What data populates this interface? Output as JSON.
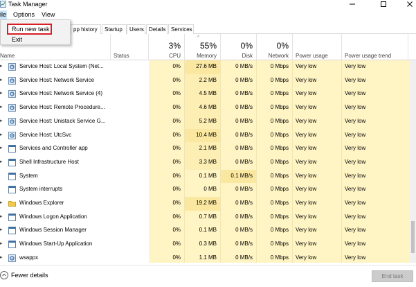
{
  "window": {
    "title": "Task Manager"
  },
  "menubar": {
    "file": "ile",
    "options": "Options",
    "view": "View"
  },
  "file_menu": {
    "items": [
      {
        "label": "Run new task"
      },
      {
        "label": "Exit"
      }
    ]
  },
  "tabs": [
    "pp history",
    "Startup",
    "Users",
    "Details",
    "Services"
  ],
  "columns": {
    "name": "Name",
    "status": "Status",
    "cpu": {
      "pct": "3%",
      "label": "CPU"
    },
    "memory": {
      "pct": "55%",
      "label": "Memory"
    },
    "disk": {
      "pct": "0%",
      "label": "Disk"
    },
    "network": {
      "pct": "0%",
      "label": "Network"
    },
    "power": "Power usage",
    "trend": "Power usage trend"
  },
  "rows": [
    {
      "expand": true,
      "icon": "gear-service-icon",
      "name": "Service Host: Local System (Net...",
      "cpu": "0%",
      "mem": "27.6 MB",
      "disk": "0 MB/s",
      "net": "0 Mbps",
      "power": "Very low",
      "trend": "Very low"
    },
    {
      "expand": true,
      "icon": "gear-service-icon",
      "name": "Service Host: Network Service",
      "cpu": "0%",
      "mem": "2.2 MB",
      "disk": "0 MB/s",
      "net": "0 Mbps",
      "power": "Very low",
      "trend": "Very low"
    },
    {
      "expand": true,
      "icon": "gear-service-icon",
      "name": "Service Host: Network Service (4)",
      "cpu": "0%",
      "mem": "4.5 MB",
      "disk": "0 MB/s",
      "net": "0 Mbps",
      "power": "Very low",
      "trend": "Very low"
    },
    {
      "expand": true,
      "icon": "gear-service-icon",
      "name": "Service Host: Remote Procedure...",
      "cpu": "0%",
      "mem": "4.6 MB",
      "disk": "0 MB/s",
      "net": "0 Mbps",
      "power": "Very low",
      "trend": "Very low"
    },
    {
      "expand": true,
      "icon": "gear-service-icon",
      "name": "Service Host: Unistack Service G...",
      "cpu": "0%",
      "mem": "5.2 MB",
      "disk": "0 MB/s",
      "net": "0 Mbps",
      "power": "Very low",
      "trend": "Very low"
    },
    {
      "expand": true,
      "icon": "gear-service-icon",
      "name": "Service Host: UtcSvc",
      "cpu": "0%",
      "mem": "10.4 MB",
      "disk": "0 MB/s",
      "net": "0 Mbps",
      "power": "Very low",
      "trend": "Very low"
    },
    {
      "expand": true,
      "icon": "window-app-icon",
      "name": "Services and Controller app",
      "cpu": "0%",
      "mem": "2.1 MB",
      "disk": "0 MB/s",
      "net": "0 Mbps",
      "power": "Very low",
      "trend": "Very low"
    },
    {
      "expand": true,
      "icon": "window-app-icon",
      "name": "Shell Infrastructure Host",
      "cpu": "0%",
      "mem": "3.3 MB",
      "disk": "0 MB/s",
      "net": "0 Mbps",
      "power": "Very low",
      "trend": "Very low"
    },
    {
      "expand": false,
      "icon": "window-app-icon",
      "name": "System",
      "cpu": "0%",
      "mem": "0.1 MB",
      "disk": "0.1 MB/s",
      "net": "0 Mbps",
      "power": "Very low",
      "trend": "Very low"
    },
    {
      "expand": false,
      "icon": "window-app-icon",
      "name": "System interrupts",
      "cpu": "0%",
      "mem": "0 MB",
      "disk": "0 MB/s",
      "net": "0 Mbps",
      "power": "Very low",
      "trend": "Very low"
    },
    {
      "expand": true,
      "icon": "folder-icon",
      "name": "Windows Explorer",
      "cpu": "0%",
      "mem": "19.2 MB",
      "disk": "0 MB/s",
      "net": "0 Mbps",
      "power": "Very low",
      "trend": "Very low"
    },
    {
      "expand": true,
      "icon": "window-app-icon",
      "name": "Windows Logon Application",
      "cpu": "0%",
      "mem": "0.7 MB",
      "disk": "0 MB/s",
      "net": "0 Mbps",
      "power": "Very low",
      "trend": "Very low"
    },
    {
      "expand": true,
      "icon": "window-app-icon",
      "name": "Windows Session Manager",
      "cpu": "0%",
      "mem": "0.1 MB",
      "disk": "0 MB/s",
      "net": "0 Mbps",
      "power": "Very low",
      "trend": "Very low"
    },
    {
      "expand": true,
      "icon": "window-app-icon",
      "name": "Windows Start-Up Application",
      "cpu": "0%",
      "mem": "0.3 MB",
      "disk": "0 MB/s",
      "net": "0 Mbps",
      "power": "Very low",
      "trend": "Very low"
    },
    {
      "expand": true,
      "icon": "gear-service-icon",
      "name": "wsappx",
      "cpu": "0%",
      "mem": "1.1 MB",
      "disk": "0 MB/s",
      "net": "0 Mbps",
      "power": "Very low",
      "trend": "Very low"
    }
  ],
  "footer": {
    "fewer_details": "Fewer details",
    "end_task": "End task"
  },
  "colors": {
    "heat_light": "#fff4c4",
    "heat_dark": "#fbe8a0",
    "menu_highlight": "#cce4f7",
    "callout_red": "#d81f26"
  }
}
